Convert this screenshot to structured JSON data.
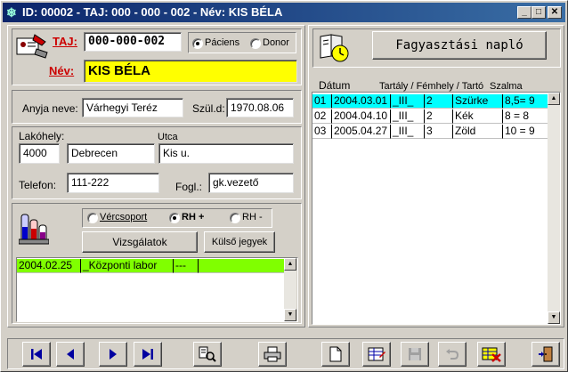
{
  "window": {
    "title": "ID: 00002  -  TAJ: 000 - 000 - 002  -  Név: KIS BÉLA",
    "controls": {
      "minimize": "_",
      "maximize": "□",
      "close": "✕"
    }
  },
  "patient": {
    "taj_label": "TAJ:",
    "taj_value": "000-000-002",
    "type_options": [
      {
        "label": "Páciens",
        "selected": true
      },
      {
        "label": "Donor",
        "selected": false
      }
    ],
    "name_label": "Név:",
    "name_value": "KIS BÉLA",
    "mother_label": "Anyja neve:",
    "mother_value": "Várhegyi Teréz",
    "birth_label": "Szül.d:",
    "birth_value": "1970.08.06",
    "address_label": "Lakóhely:",
    "street_label": "Utca",
    "zip_value": "4000",
    "city_value": "Debrecen",
    "street_value": "Kis u.",
    "phone_label": "Telefon:",
    "phone_value": "111-222",
    "job_label": "Fogl.:",
    "job_value": "gk.vezető"
  },
  "blood": {
    "options": [
      {
        "label": "Vércsoport",
        "selected": false
      },
      {
        "label": "RH +",
        "selected": true
      },
      {
        "label": "RH -",
        "selected": false
      }
    ],
    "exams_button": "Vizsgálatok",
    "external_button": "Külső jegyek",
    "rows": [
      {
        "date": "2004.02.25",
        "place": "_Központi labor",
        "result": "---",
        "extra": ""
      }
    ],
    "row_color": "#80ff00"
  },
  "freeze": {
    "button_label": "Fagyasztási napló",
    "headers": {
      "date": "Dátum",
      "tank": "Tartály / Fémhely / Tartó",
      "straw": "Szalma"
    },
    "rows": [
      {
        "no": "01",
        "date": "2004.03.01",
        "tank": "_III_",
        "pos": "2",
        "holder": "Szürke",
        "straw": "8,5= 9",
        "selected": true
      },
      {
        "no": "02",
        "date": "2004.04.10",
        "tank": "_III_",
        "pos": "2",
        "holder": "Kék",
        "straw": "8 = 8",
        "selected": false
      },
      {
        "no": "03",
        "date": "2005.04.27",
        "tank": "_III_",
        "pos": "3",
        "holder": "Zöld",
        "straw": "10 = 9",
        "selected": false
      }
    ],
    "selected_color": "#00ffff"
  },
  "colors": {
    "title_start": "#0a246a",
    "title_end": "#3a6ea5",
    "name_highlight": "#ffff00",
    "label_red": "#cc0000",
    "nav_blue": "#0000a0"
  },
  "icons": {
    "app": "snowflake-icon",
    "patient": "patient-card-icon",
    "tubes": "test-tubes-icon",
    "book": "book-clock-icon"
  }
}
